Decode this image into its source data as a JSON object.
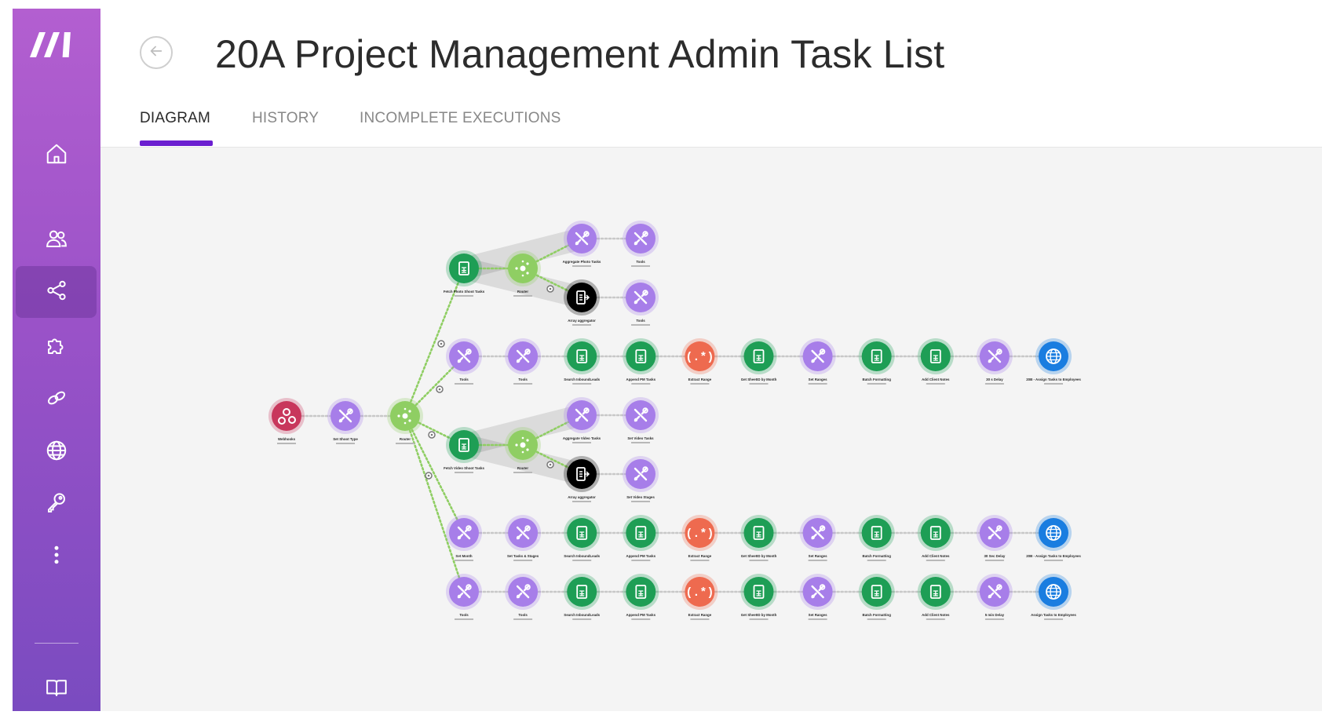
{
  "app": {
    "logo_icon": "make-logo-icon",
    "accent_color": "#6b1fd0",
    "sidebar_color": "#9a52c8"
  },
  "sidebar": {
    "items": [
      {
        "name": "home",
        "icon": "home-icon"
      },
      {
        "name": "team",
        "icon": "users-icon"
      },
      {
        "name": "scenarios",
        "icon": "share-nodes-icon",
        "active": true
      },
      {
        "name": "templates",
        "icon": "puzzle-icon"
      },
      {
        "name": "connections",
        "icon": "link-icon"
      },
      {
        "name": "webhooks",
        "icon": "globe-icon"
      },
      {
        "name": "keys",
        "icon": "key-icon"
      },
      {
        "name": "more",
        "icon": "more-vertical-icon"
      },
      {
        "name": "docs",
        "icon": "book-icon"
      }
    ]
  },
  "header": {
    "title": "20A Project Management Admin Task List",
    "back_icon": "arrow-left-icon",
    "tabs": [
      {
        "label": "DIAGRAM",
        "active": true
      },
      {
        "label": "HISTORY"
      },
      {
        "label": "INCOMPLETE EXECUTIONS"
      }
    ]
  },
  "diagram": {
    "module_colors": {
      "webhook": "#c8375c",
      "tools": "#a77ee9",
      "router": "#8fce63",
      "sheets": "#1e9e55",
      "regexp": "#ee6a4f",
      "http": "#1a7de0"
    },
    "modules": {
      "webhook": "Webhooks",
      "set_shoot_type": "Set Shoot Type",
      "router_main": "Router",
      "fetch_photo": "Fetch Photo Shoot Tasks",
      "router_photo": "Router",
      "agg_photo": "Aggregate Photo Tasks",
      "tools_photo": "Tools",
      "array_agg_photo": "Array aggregator",
      "tools_photo2": "Tools",
      "fetch_video": "Fetch Video Shoot Tasks",
      "router_video": "Router",
      "agg_video": "Aggregate Video Tasks",
      "set_video_tasks": "Set Video Tasks",
      "array_agg_video": "Array aggregator",
      "set_video_stages": "Set Video Stages"
    },
    "rows": [
      [
        "Tools",
        "Tools",
        "Search InboundLeads",
        "Append PM Tasks",
        "Extract Range",
        "Get SheetID by Month",
        "Set Ranges",
        "Batch Formatting",
        "Add Client Notes",
        "30 s Delay",
        "20B - Assign Tasks to Employees"
      ],
      [
        "Set Month",
        "Set Tasks & Stages",
        "Search InboundLeads",
        "Append PM Tasks",
        "Extract Range",
        "Get SheetID by Month",
        "Set Ranges",
        "Batch Formatting",
        "Add Client Notes",
        "30 Sec Delay",
        "20B - Assign Tasks to Employees"
      ],
      [
        "Tools",
        "Tools",
        "Search InboundLeads",
        "Append PM Tasks",
        "Extract Range",
        "Get SheetID by Month",
        "Set Ranges",
        "Batch Formatting",
        "Add Client Notes",
        "5 min Delay",
        "Assign Tasks to Employees"
      ]
    ]
  }
}
